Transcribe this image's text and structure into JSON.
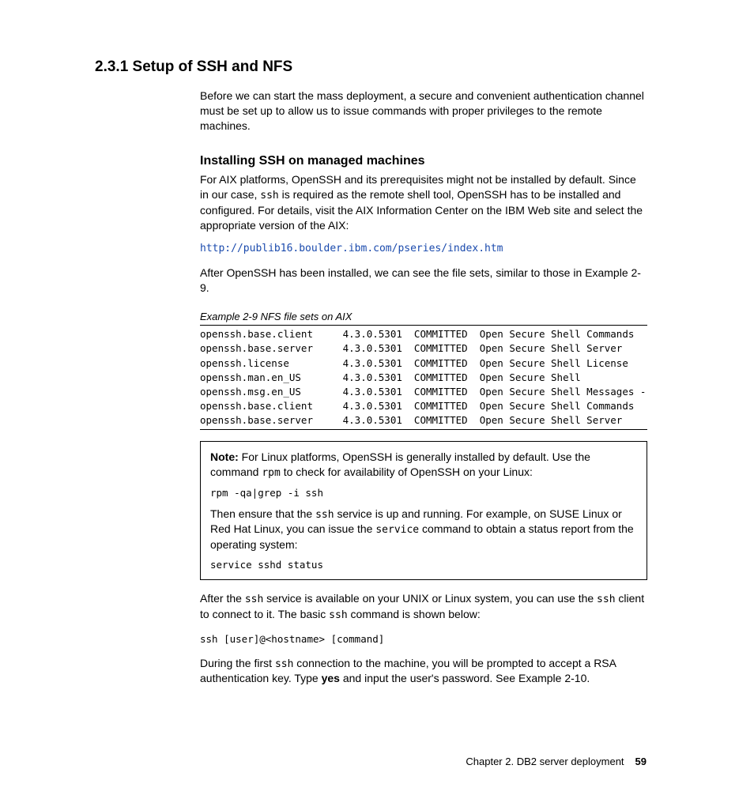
{
  "heading": "2.3.1  Setup of SSH and NFS",
  "intro": "Before we can start the mass deployment, a secure and convenient authentication channel must be set up to allow us to issue commands with proper privileges to the remote machines.",
  "sub1": "Installing SSH on managed machines",
  "p1a": "For AIX platforms, OpenSSH and its prerequisites might not be installed by default. Since in our case, ",
  "p1b": " is required as the remote shell tool, OpenSSH has to be installed and configured. For details, visit the AIX Information Center on the IBM Web site and select the appropriate version of the AIX:",
  "ssh": "ssh",
  "link": "http://publib16.boulder.ibm.com/pseries/index.htm",
  "p2": "After OpenSSH has been installed, we can see the file sets, similar to those in Example 2-9.",
  "example_caption": "Example 2-9   NFS file sets on AIX",
  "filesets": "openssh.base.client     4.3.0.5301  COMMITTED  Open Secure Shell Commands\nopenssh.base.server     4.3.0.5301  COMMITTED  Open Secure Shell Server\nopenssh.license         4.3.0.5301  COMMITTED  Open Secure Shell License\nopenssh.man.en_US       4.3.0.5301  COMMITTED  Open Secure Shell\nopenssh.msg.en_US       4.3.0.5301  COMMITTED  Open Secure Shell Messages -\nopenssh.base.client     4.3.0.5301  COMMITTED  Open Secure Shell Commands\nopenssh.base.server     4.3.0.5301  COMMITTED  Open Secure Shell Server",
  "note": {
    "lead": "Note:",
    "p1a": " For Linux platforms, OpenSSH is generally installed by default. Use the command ",
    "rpm": "rpm",
    "p1b": " to check for availability of OpenSSH on your Linux:",
    "cmd1": "rpm -qa|grep -i ssh",
    "p2a": "Then ensure that the ",
    "p2b": " service is up and running. For example, on SUSE Linux or Red Hat Linux, you can issue the ",
    "service": "service",
    "p2c": " command to obtain a status report from the operating system:",
    "cmd2": "service sshd status"
  },
  "p3a": "After the ",
  "p3b": " service is available on your UNIX or Linux system, you can use the ",
  "p3c": " client to connect to it. The basic ",
  "p3d": " command is shown below:",
  "cmd3": "ssh [user]@<hostname> [command]",
  "p4a": "During the first ",
  "p4b": " connection to the machine, you will be prompted to accept a RSA authentication key. Type ",
  "yes": "yes",
  "p4c": " and input the user's password. See Example 2-10.",
  "footer_chapter": "Chapter 2. DB2 server deployment",
  "footer_page": "59"
}
